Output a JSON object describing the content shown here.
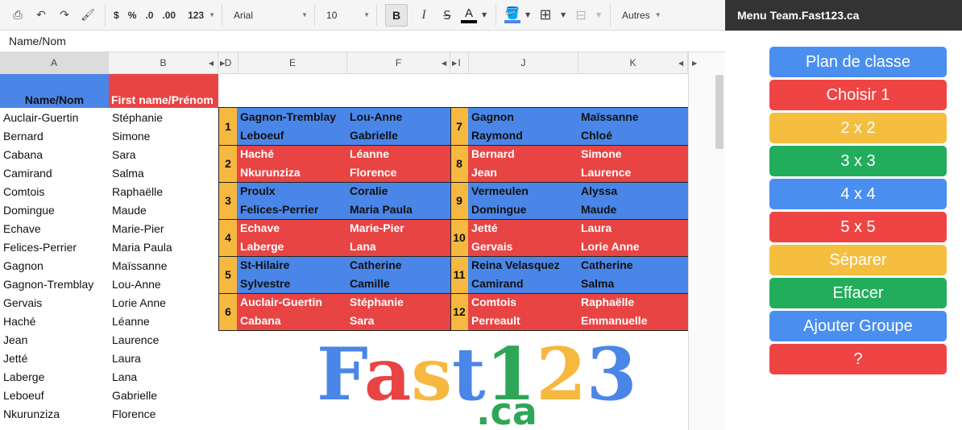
{
  "toolbar": {
    "currency": "$",
    "percent": "%",
    "dec_less": ".0",
    "dec_more": ".00",
    "format_123": "123",
    "font": "Arial",
    "size": "10",
    "bold": "B",
    "italic": "I",
    "strike": "S",
    "textcolor": "A",
    "more": "Autres"
  },
  "panel_title": "Menu Team.Fast123.ca",
  "formula": "Name/Nom",
  "columns": [
    "A",
    "B",
    "D",
    "E",
    "F",
    "I",
    "J",
    "K"
  ],
  "header": {
    "a": "Name/Nom",
    "b": "First name/Prénom"
  },
  "list": [
    [
      "Auclair-Guertin",
      "Stéphanie"
    ],
    [
      "Bernard",
      "Simone"
    ],
    [
      "Cabana",
      "Sara"
    ],
    [
      "Camirand",
      "Salma"
    ],
    [
      "Comtois",
      "Raphaëlle"
    ],
    [
      "Domingue",
      "Maude"
    ],
    [
      "Echave",
      "Marie-Pier"
    ],
    [
      "Felices-Perrier",
      "Maria Paula"
    ],
    [
      "Gagnon",
      "Maïssanne"
    ],
    [
      "Gagnon-Tremblay",
      "Lou-Anne"
    ],
    [
      "Gervais",
      "Lorie Anne"
    ],
    [
      "Haché",
      "Léanne"
    ],
    [
      "Jean",
      "Laurence"
    ],
    [
      "Jetté",
      "Laura"
    ],
    [
      "Laberge",
      "Lana"
    ],
    [
      "Leboeuf",
      "Gabrielle"
    ],
    [
      "Nkurunziza",
      "Florence"
    ]
  ],
  "groups": [
    {
      "n": "1",
      "color": "blue",
      "r1": [
        "Gagnon-Tremblay",
        "Lou-Anne"
      ],
      "r2": [
        "Leboeuf",
        "Gabrielle"
      ]
    },
    {
      "n": "2",
      "color": "red",
      "r1": [
        "Haché",
        "Léanne"
      ],
      "r2": [
        "Nkurunziza",
        "Florence"
      ]
    },
    {
      "n": "3",
      "color": "blue",
      "r1": [
        "Proulx",
        "Coralie"
      ],
      "r2": [
        "Felices-Perrier",
        "Maria Paula"
      ]
    },
    {
      "n": "4",
      "color": "red",
      "r1": [
        "Echave",
        "Marie-Pier"
      ],
      "r2": [
        "Laberge",
        "Lana"
      ]
    },
    {
      "n": "5",
      "color": "blue",
      "r1": [
        "St-Hilaire",
        "Catherine"
      ],
      "r2": [
        "Sylvestre",
        "Camille"
      ]
    },
    {
      "n": "6",
      "color": "red",
      "r1": [
        "Auclair-Guertin",
        "Stéphanie"
      ],
      "r2": [
        "Cabana",
        "Sara"
      ]
    },
    {
      "n": "7",
      "color": "blue",
      "r1": [
        "Gagnon",
        "Maïssanne"
      ],
      "r2": [
        "Raymond",
        "Chloé"
      ]
    },
    {
      "n": "8",
      "color": "red",
      "r1": [
        "Bernard",
        "Simone"
      ],
      "r2": [
        "Jean",
        "Laurence"
      ]
    },
    {
      "n": "9",
      "color": "blue",
      "r1": [
        "Vermeulen",
        "Alyssa"
      ],
      "r2": [
        "Domingue",
        "Maude"
      ]
    },
    {
      "n": "10",
      "color": "red",
      "r1": [
        "Jetté",
        "Laura"
      ],
      "r2": [
        "Gervais",
        "Lorie Anne"
      ]
    },
    {
      "n": "11",
      "color": "blue",
      "r1": [
        "Reina Velasquez",
        "Catherine"
      ],
      "r2": [
        "Camirand",
        "Salma"
      ]
    },
    {
      "n": "12",
      "color": "red",
      "r1": [
        "Comtois",
        "Raphaëlle"
      ],
      "r2": [
        "Perreault",
        "Emmanuelle"
      ]
    }
  ],
  "logo": {
    "main": [
      "F",
      "a",
      "s",
      "t",
      "1",
      "2",
      "3"
    ],
    "domain": ".ca"
  },
  "logo_colors": [
    "#4a86e8",
    "#e84444",
    "#f6b83f",
    "#4a86e8",
    "#2fa657",
    "#f6b83f",
    "#4a86e8"
  ],
  "buttons": [
    {
      "label": "Plan de classe",
      "color": "#4a8ff0"
    },
    {
      "label": "Choisir 1",
      "color": "#ef4444"
    },
    {
      "label": "2 x 2",
      "color": "#f6be3f"
    },
    {
      "label": "3 x 3",
      "color": "#22ad5c"
    },
    {
      "label": "4 x 4",
      "color": "#4a8ff0"
    },
    {
      "label": "5 x 5",
      "color": "#ef4444"
    },
    {
      "label": "Séparer",
      "color": "#f6be3f"
    },
    {
      "label": "Effacer",
      "color": "#22ad5c"
    },
    {
      "label": "Ajouter Groupe",
      "color": "#4a8ff0"
    },
    {
      "label": "?",
      "color": "#ef4444"
    }
  ]
}
